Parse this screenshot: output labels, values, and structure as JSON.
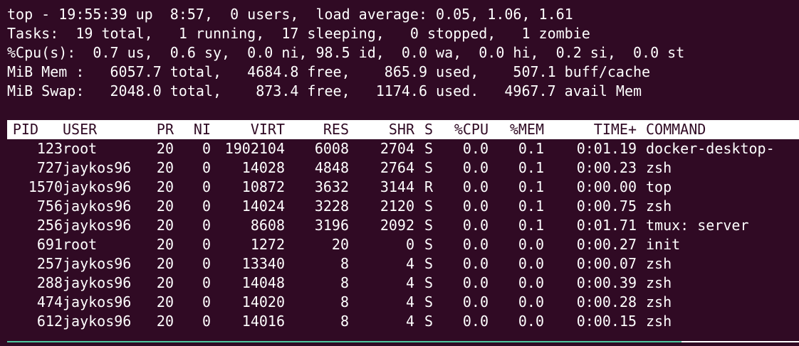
{
  "summary": {
    "line1": "top - 19:55:39 up  8:57,  0 users,  load average: 0.05, 1.06, 1.61",
    "line2": "Tasks:  19 total,   1 running,  17 sleeping,   0 stopped,   1 zombie",
    "line3": "%Cpu(s):  0.7 us,  0.6 sy,  0.0 ni, 98.5 id,  0.0 wa,  0.0 hi,  0.2 si,  0.0 st",
    "line4": "MiB Mem :   6057.7 total,   4684.8 free,    865.9 used,    507.1 buff/cache",
    "line5": "MiB Swap:   2048.0 total,    873.4 free,   1174.6 used.   4967.7 avail Mem"
  },
  "table": {
    "headers": {
      "pid": "PID",
      "user": "USER",
      "pr": "PR",
      "ni": "NI",
      "virt": "VIRT",
      "res": "RES",
      "shr": "SHR",
      "s": "S",
      "cpu": "%CPU",
      "mem": "%MEM",
      "time": "TIME+",
      "command": "COMMAND"
    },
    "rows": [
      {
        "pid": "123",
        "user": "root",
        "pr": "20",
        "ni": "0",
        "virt": "1902104",
        "res": "6008",
        "shr": "2704",
        "s": "S",
        "cpu": "0.0",
        "mem": "0.1",
        "time": "0:01.19",
        "command": "docker-desktop-"
      },
      {
        "pid": "727",
        "user": "jaykos96",
        "pr": "20",
        "ni": "0",
        "virt": "14028",
        "res": "4848",
        "shr": "2764",
        "s": "S",
        "cpu": "0.0",
        "mem": "0.1",
        "time": "0:00.23",
        "command": "zsh"
      },
      {
        "pid": "1570",
        "user": "jaykos96",
        "pr": "20",
        "ni": "0",
        "virt": "10872",
        "res": "3632",
        "shr": "3144",
        "s": "R",
        "cpu": "0.0",
        "mem": "0.1",
        "time": "0:00.00",
        "command": "top"
      },
      {
        "pid": "756",
        "user": "jaykos96",
        "pr": "20",
        "ni": "0",
        "virt": "14024",
        "res": "3228",
        "shr": "2120",
        "s": "S",
        "cpu": "0.0",
        "mem": "0.1",
        "time": "0:00.75",
        "command": "zsh"
      },
      {
        "pid": "256",
        "user": "jaykos96",
        "pr": "20",
        "ni": "0",
        "virt": "8608",
        "res": "3196",
        "shr": "2092",
        "s": "S",
        "cpu": "0.0",
        "mem": "0.1",
        "time": "0:01.71",
        "command": "tmux: server"
      },
      {
        "pid": "691",
        "user": "root",
        "pr": "20",
        "ni": "0",
        "virt": "1272",
        "res": "20",
        "shr": "0",
        "s": "S",
        "cpu": "0.0",
        "mem": "0.0",
        "time": "0:00.27",
        "command": "init"
      },
      {
        "pid": "257",
        "user": "jaykos96",
        "pr": "20",
        "ni": "0",
        "virt": "13340",
        "res": "8",
        "shr": "4",
        "s": "S",
        "cpu": "0.0",
        "mem": "0.0",
        "time": "0:00.07",
        "command": "zsh"
      },
      {
        "pid": "288",
        "user": "jaykos96",
        "pr": "20",
        "ni": "0",
        "virt": "14048",
        "res": "8",
        "shr": "4",
        "s": "S",
        "cpu": "0.0",
        "mem": "0.0",
        "time": "0:00.39",
        "command": "zsh"
      },
      {
        "pid": "474",
        "user": "jaykos96",
        "pr": "20",
        "ni": "0",
        "virt": "14020",
        "res": "8",
        "shr": "4",
        "s": "S",
        "cpu": "0.0",
        "mem": "0.0",
        "time": "0:00.28",
        "command": "zsh"
      },
      {
        "pid": "612",
        "user": "jaykos96",
        "pr": "20",
        "ni": "0",
        "virt": "14016",
        "res": "8",
        "shr": "4",
        "s": "S",
        "cpu": "0.0",
        "mem": "0.0",
        "time": "0:00.15",
        "command": "zsh"
      }
    ]
  },
  "colors": {
    "background": "#300a24",
    "foreground": "#ffffff",
    "header_bar": "#ffffff",
    "status_bar_accent": "#4ec9a0"
  }
}
